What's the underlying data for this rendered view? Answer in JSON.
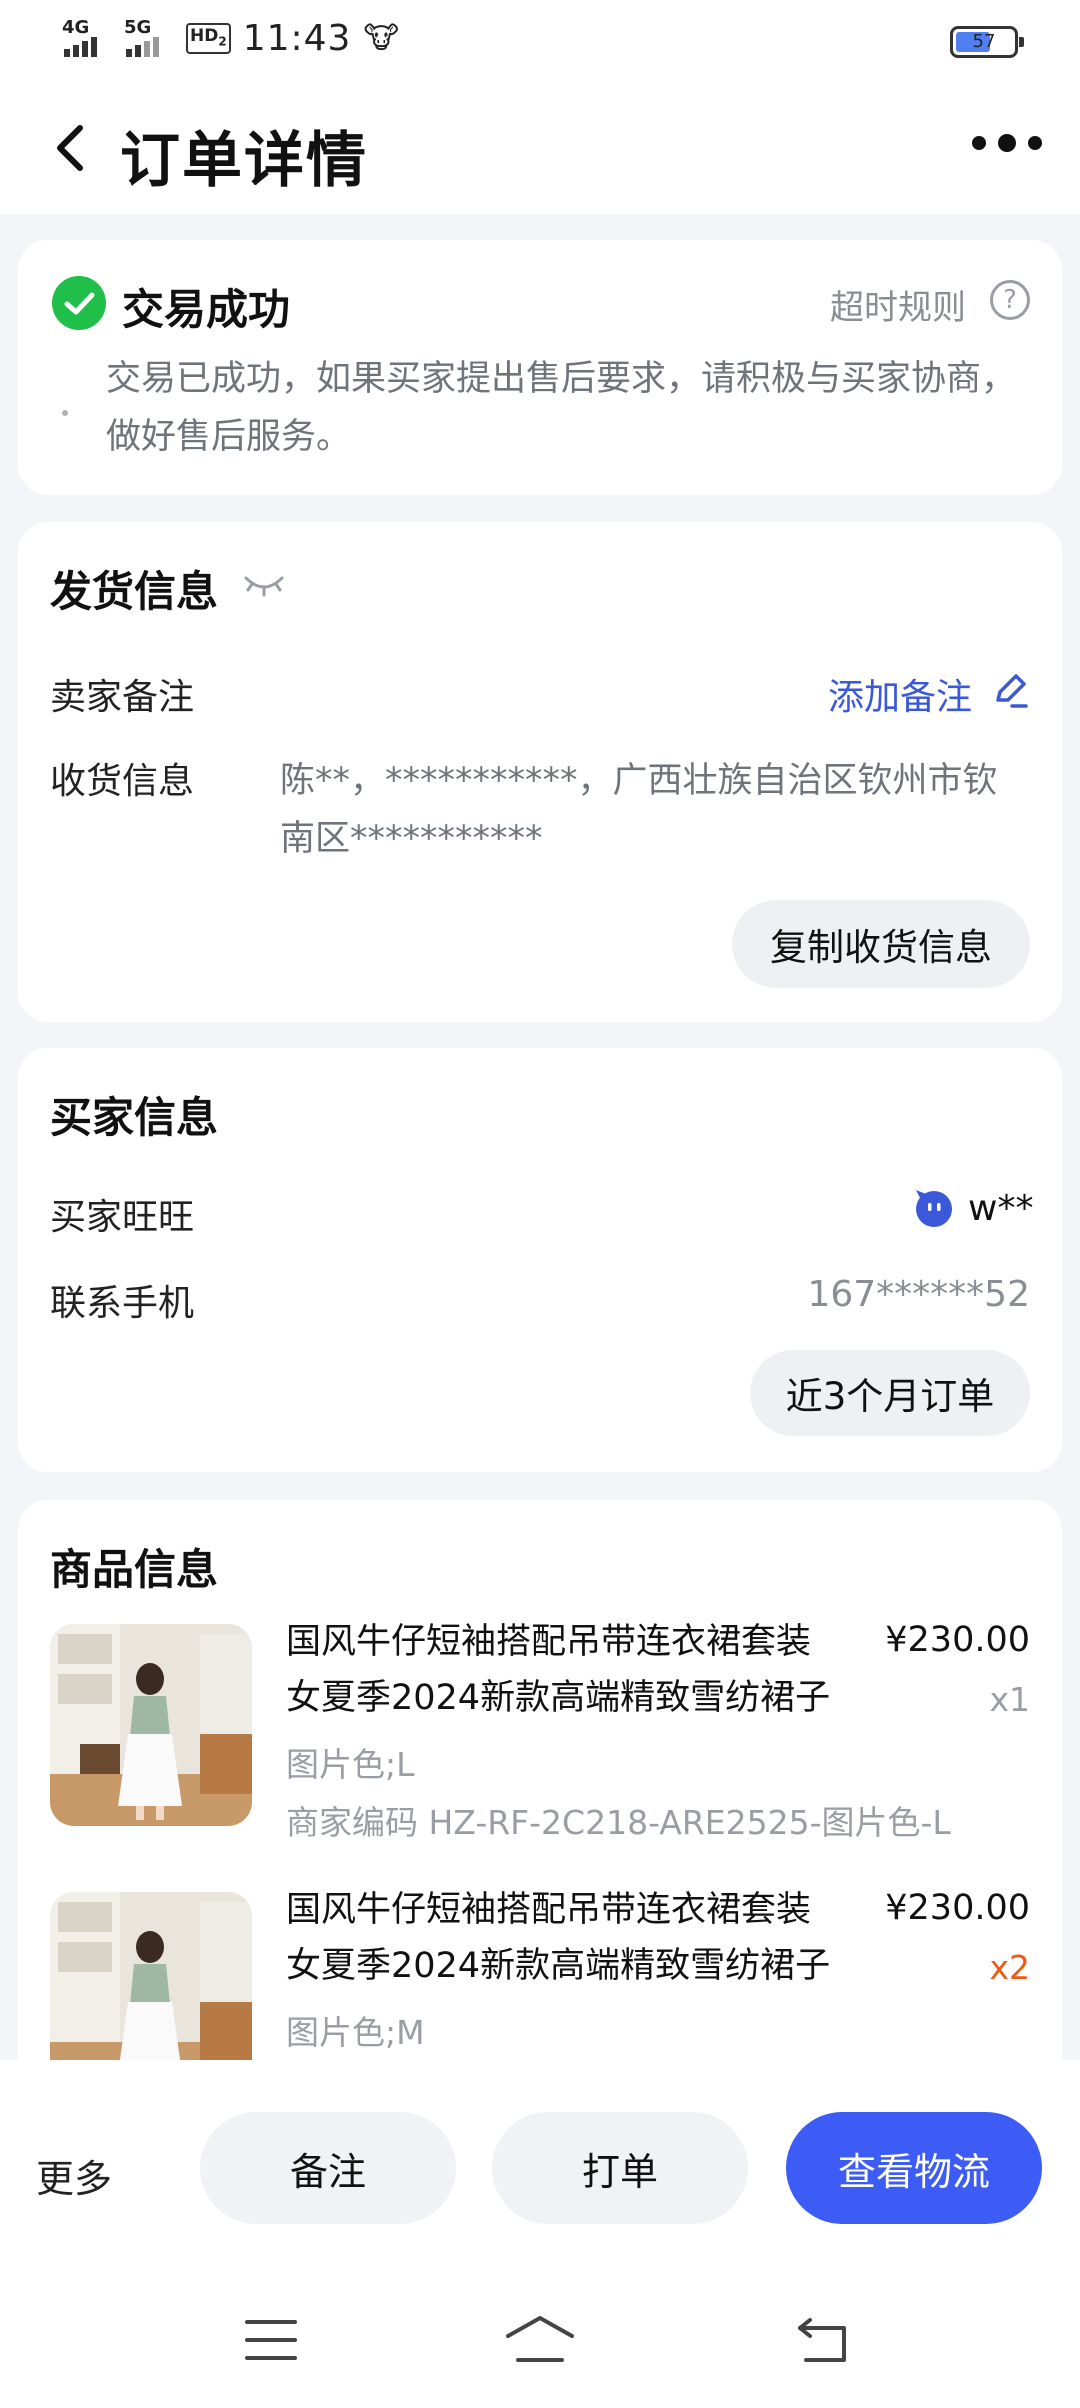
{
  "status_bar": {
    "signal1_label": "4G",
    "signal2_label": "5G",
    "hd_label": "HD",
    "sim_label": "2",
    "time": "11:43",
    "battery": "57"
  },
  "nav": {
    "title": "订单详情"
  },
  "status_card": {
    "title": "交易成功",
    "rule_link": "超时规则",
    "rule_icon": "?",
    "description": "交易已成功，如果买家提出售后要求，请积极与买家协商，做好售后服务。"
  },
  "shipping": {
    "title": "发货信息",
    "seller_note_label": "卖家备注",
    "add_note": "添加备注",
    "address_label": "收货信息",
    "address_line1": "陈**，***********，广西壮族自治区钦州市钦",
    "address_line2": "南区***********",
    "copy_button": "复制收货信息"
  },
  "buyer": {
    "title": "买家信息",
    "wangwang_label": "买家旺旺",
    "wangwang_value": "w**",
    "phone_label": "联系手机",
    "phone_value": "167******52",
    "orders_button": "近3个月订单"
  },
  "goods": {
    "title": "商品信息",
    "items": [
      {
        "title_line1": "国风牛仔短袖搭配吊带连衣裙套装",
        "title_line2": "女夏季2024新款高端精致雪纺裙子",
        "price": "¥230.00",
        "qty": "x1",
        "spec": "图片色;L",
        "code": "商家编码 HZ-RF-2C218-ARE2525-图片色-L"
      },
      {
        "title_line1": "国风牛仔短袖搭配吊带连衣裙套装",
        "title_line2": "女夏季2024新款高端精致雪纺裙子",
        "price": "¥230.00",
        "qty": "x2",
        "spec": "图片色;M"
      }
    ]
  },
  "bottom_bar": {
    "more": "更多",
    "note": "备注",
    "print": "打单",
    "logistics": "查看物流"
  },
  "colors": {
    "accent_blue": "#3d5cf5",
    "link_blue": "#3a58d8",
    "success_green": "#1fbf4a",
    "qty_orange": "#f05a14"
  }
}
